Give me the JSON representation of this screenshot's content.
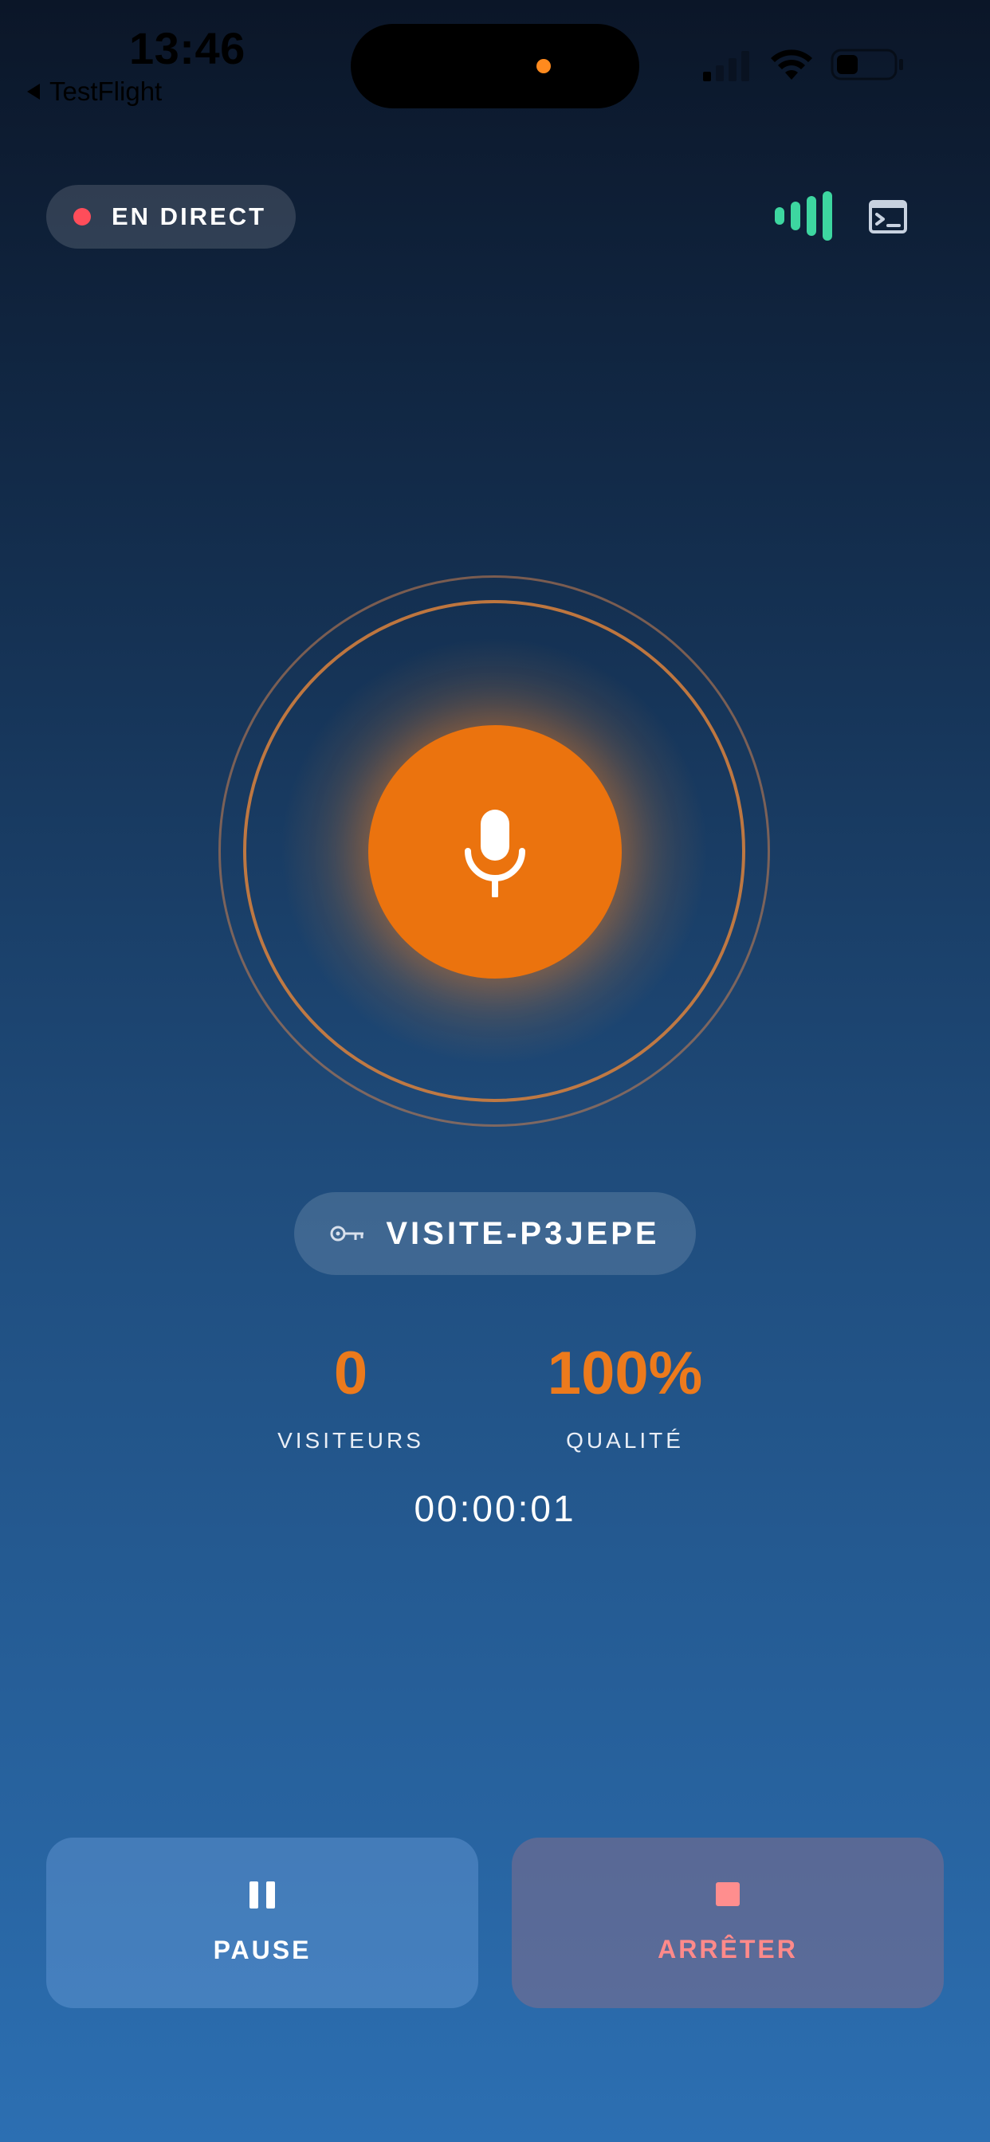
{
  "status_bar": {
    "time": "13:46",
    "back_app": "TestFlight"
  },
  "header": {
    "live_label": "EN DIRECT",
    "icons": [
      "audio-level-icon",
      "console-icon"
    ]
  },
  "session": {
    "code": "VISITE-P3JEPE"
  },
  "stats": {
    "visitors": {
      "value": "0",
      "label": "VISITEURS"
    },
    "quality": {
      "value": "100%",
      "label": "QUALITÉ"
    },
    "timer": "00:00:01"
  },
  "actions": {
    "pause_label": "PAUSE",
    "stop_label": "ARRÊTER"
  },
  "colors": {
    "accent": "#eb730e",
    "live_dot": "#ff4d5a",
    "level_bars": "#3dd6a0",
    "stop_text": "#ff8a8a"
  }
}
